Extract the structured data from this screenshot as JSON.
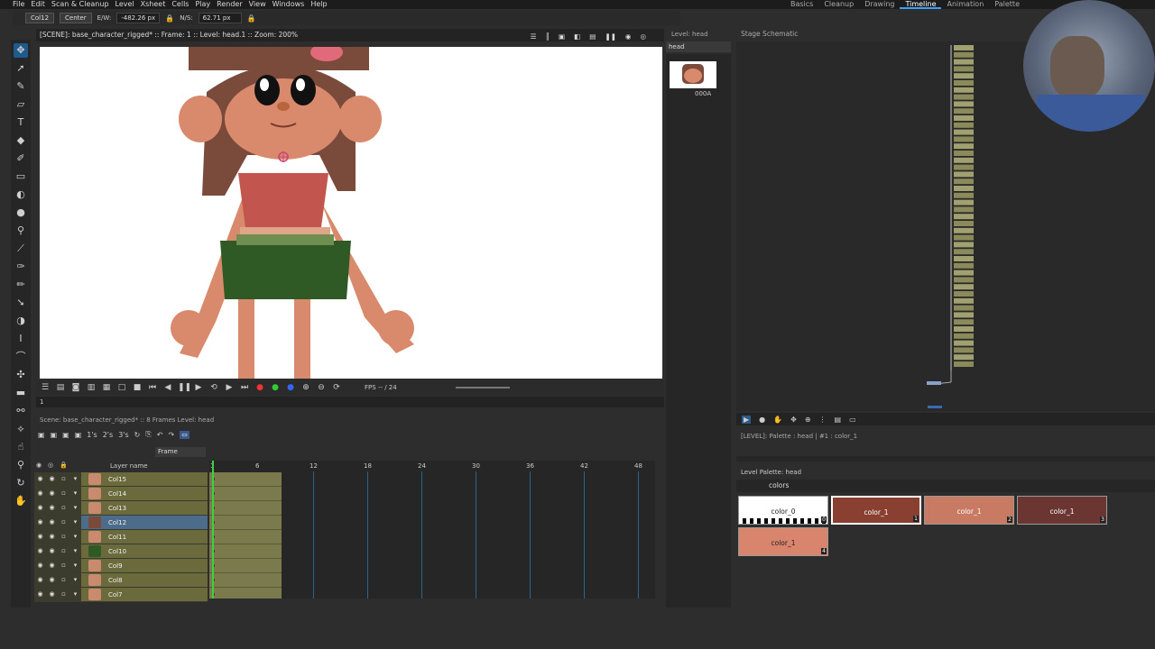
{
  "menu": [
    "File",
    "Edit",
    "Scan & Cleanup",
    "Level",
    "Xsheet",
    "Cells",
    "Play",
    "Render",
    "View",
    "Windows",
    "Help"
  ],
  "rooms": [
    "Basics",
    "Cleanup",
    "Drawing",
    "Timeline",
    "Animation",
    "Palette"
  ],
  "active_room": "Timeline",
  "tool_options": {
    "column": "Col12",
    "center": "Center",
    "ew_label": "E/W:",
    "ew_value": "-482.26 px",
    "ns_label": "N/S:",
    "ns_value": "62.71 px"
  },
  "viewer": {
    "title": "[SCENE]: base_character_rigged* :: Frame: 1 :: Level: head.1 :: Zoom: 200%",
    "fps_label": "FPS",
    "fps_value": "-- / 24",
    "current_frame": "1"
  },
  "xsheet": {
    "scene_info": "Scene: base_character_rigged* :: 8 Frames Level: head",
    "step_buttons": [
      "1's",
      "2's",
      "3's"
    ],
    "frame_mode": "Frame",
    "layer_name_header": "Layer name",
    "frame_numbers": [
      "1",
      "6",
      "12",
      "18",
      "24",
      "30",
      "36",
      "42",
      "48"
    ],
    "layers": [
      {
        "name": "Col15",
        "thumb": "#c98a70",
        "selected": false
      },
      {
        "name": "Col14",
        "thumb": "#c98a70",
        "selected": false
      },
      {
        "name": "Col13",
        "thumb": "#c98a70",
        "selected": false
      },
      {
        "name": "Col12",
        "thumb": "#7a4a3a",
        "selected": true
      },
      {
        "name": "Col11",
        "thumb": "#c98a70",
        "selected": false
      },
      {
        "name": "Col10",
        "thumb": "#2f5a26",
        "selected": false
      },
      {
        "name": "Col9",
        "thumb": "#c98a70",
        "selected": false
      },
      {
        "name": "Col8",
        "thumb": "#c98a70",
        "selected": false
      },
      {
        "name": "Col7",
        "thumb": "#c98a70",
        "selected": false
      }
    ]
  },
  "level_strip": {
    "title": "Level: head",
    "level": "head",
    "frame_id": "000A"
  },
  "schematic": {
    "title": "Stage Schematic"
  },
  "palette": {
    "header": "[LEVEL]: Palette : head | #1 : color_1",
    "level_palette_title": "Level Palette: head",
    "tab": "colors",
    "styles": [
      {
        "name": "color_0",
        "index": "0",
        "color": "#ffffff",
        "text": "#222222"
      },
      {
        "name": "color_1",
        "index": "1",
        "color": "#8a4030",
        "text": "#ffffff"
      },
      {
        "name": "color_1",
        "index": "2",
        "color": "#c97a62",
        "text": "#ffffff"
      },
      {
        "name": "color_1",
        "index": "3",
        "color": "#6b3532",
        "text": "#ffffff"
      },
      {
        "name": "color_1",
        "index": "4",
        "color": "#d9846c",
        "text": "#222222"
      }
    ]
  }
}
